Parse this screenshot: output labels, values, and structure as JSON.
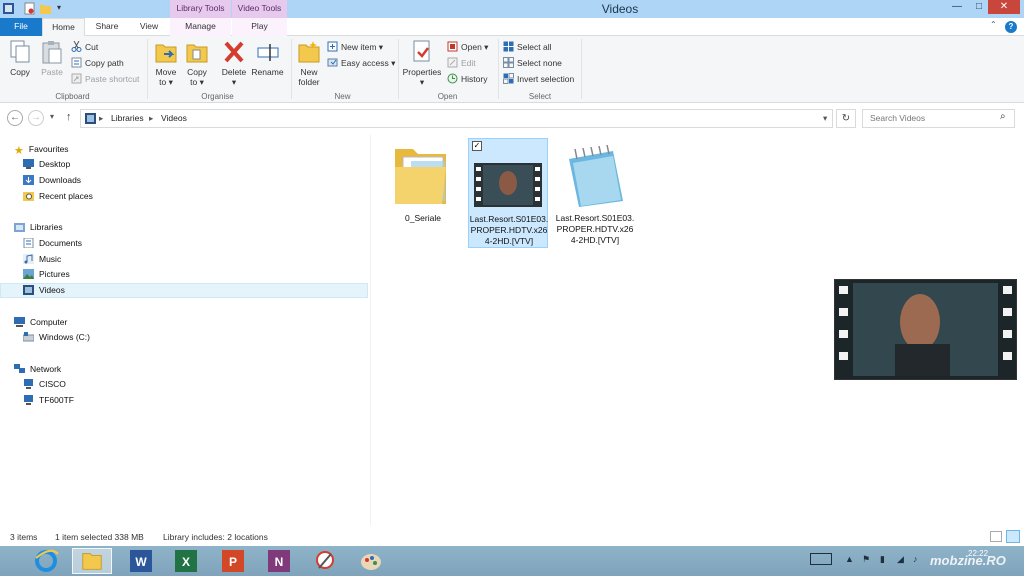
{
  "window": {
    "title": "Videos",
    "context_tabs": {
      "library_tools": "Library Tools",
      "video_tools": "Video Tools"
    },
    "controls": {
      "minimize": "—",
      "maximize": "□",
      "close": "✕"
    }
  },
  "tabs": [
    {
      "label": "File"
    },
    {
      "label": "Home"
    },
    {
      "label": "Share"
    },
    {
      "label": "View"
    },
    {
      "label": "Manage"
    },
    {
      "label": "Play"
    }
  ],
  "ribbon": {
    "clipboard": {
      "label": "Clipboard",
      "copy": "Copy",
      "paste": "Paste",
      "cut": "Cut",
      "copy_path": "Copy path",
      "paste_shortcut": "Paste shortcut"
    },
    "organise": {
      "label": "Organise",
      "move_to_1": "Move",
      "move_to_2": "to ▾",
      "copy_to_1": "Copy",
      "copy_to_2": "to ▾",
      "delete_1": "Delete",
      "delete_2": "▾",
      "rename": "Rename"
    },
    "new": {
      "label": "New",
      "new_folder_1": "New",
      "new_folder_2": "folder",
      "new_item": "New item ▾",
      "easy_access": "Easy access ▾"
    },
    "open": {
      "label": "Open",
      "properties_1": "Properties",
      "properties_2": "▾",
      "open": "Open ▾",
      "edit": "Edit",
      "history": "History"
    },
    "select": {
      "label": "Select",
      "select_all": "Select all",
      "select_none": "Select none",
      "invert_selection": "Invert selection"
    }
  },
  "address": {
    "back": "←",
    "forward": "→",
    "recent": "▾",
    "up": "↑",
    "crumbs": [
      "Libraries",
      "Videos"
    ],
    "separator": "▸",
    "dropdown": "▾",
    "refresh": "↻",
    "search_placeholder": "Search Videos"
  },
  "nav": {
    "favourites": "Favourites",
    "desktop": "Desktop",
    "downloads": "Downloads",
    "recent_places": "Recent places",
    "libraries": "Libraries",
    "documents": "Documents",
    "music": "Music",
    "pictures": "Pictures",
    "videos": "Videos",
    "computer": "Computer",
    "windows_c": "Windows (C:)",
    "network": "Network",
    "cisco": "CISCO",
    "tf600tf": "TF600TF"
  },
  "files": [
    {
      "name": "0_Seriale",
      "type": "folder-icon",
      "selected": false
    },
    {
      "name": "Last.Resort.S01E03.PROPER.HDTV.x264-2HD.[VTV]",
      "type": "video-icon",
      "selected": true
    },
    {
      "name": "Last.Resort.S01E03.PROPER.HDTV.x264-2HD.[VTV]",
      "type": "notepad-icon",
      "selected": false
    }
  ],
  "status": {
    "items": "3 items",
    "selected": "1 item selected  338 MB",
    "library": "Library includes: 2 locations"
  },
  "taskbar": {
    "clock": "22:22",
    "watermark": "mobzine.RO",
    "apps": [
      "ie-icon",
      "file-explorer-icon",
      "word-icon",
      "excel-icon",
      "powerpoint-icon",
      "onenote-icon",
      "snipping-tool-icon",
      "paint-icon"
    ]
  },
  "colors": {
    "accent": "#1979ca",
    "titlebar": "#aed5f5",
    "context_tab": "#e7c9ee",
    "selection": "#cce8ff"
  }
}
